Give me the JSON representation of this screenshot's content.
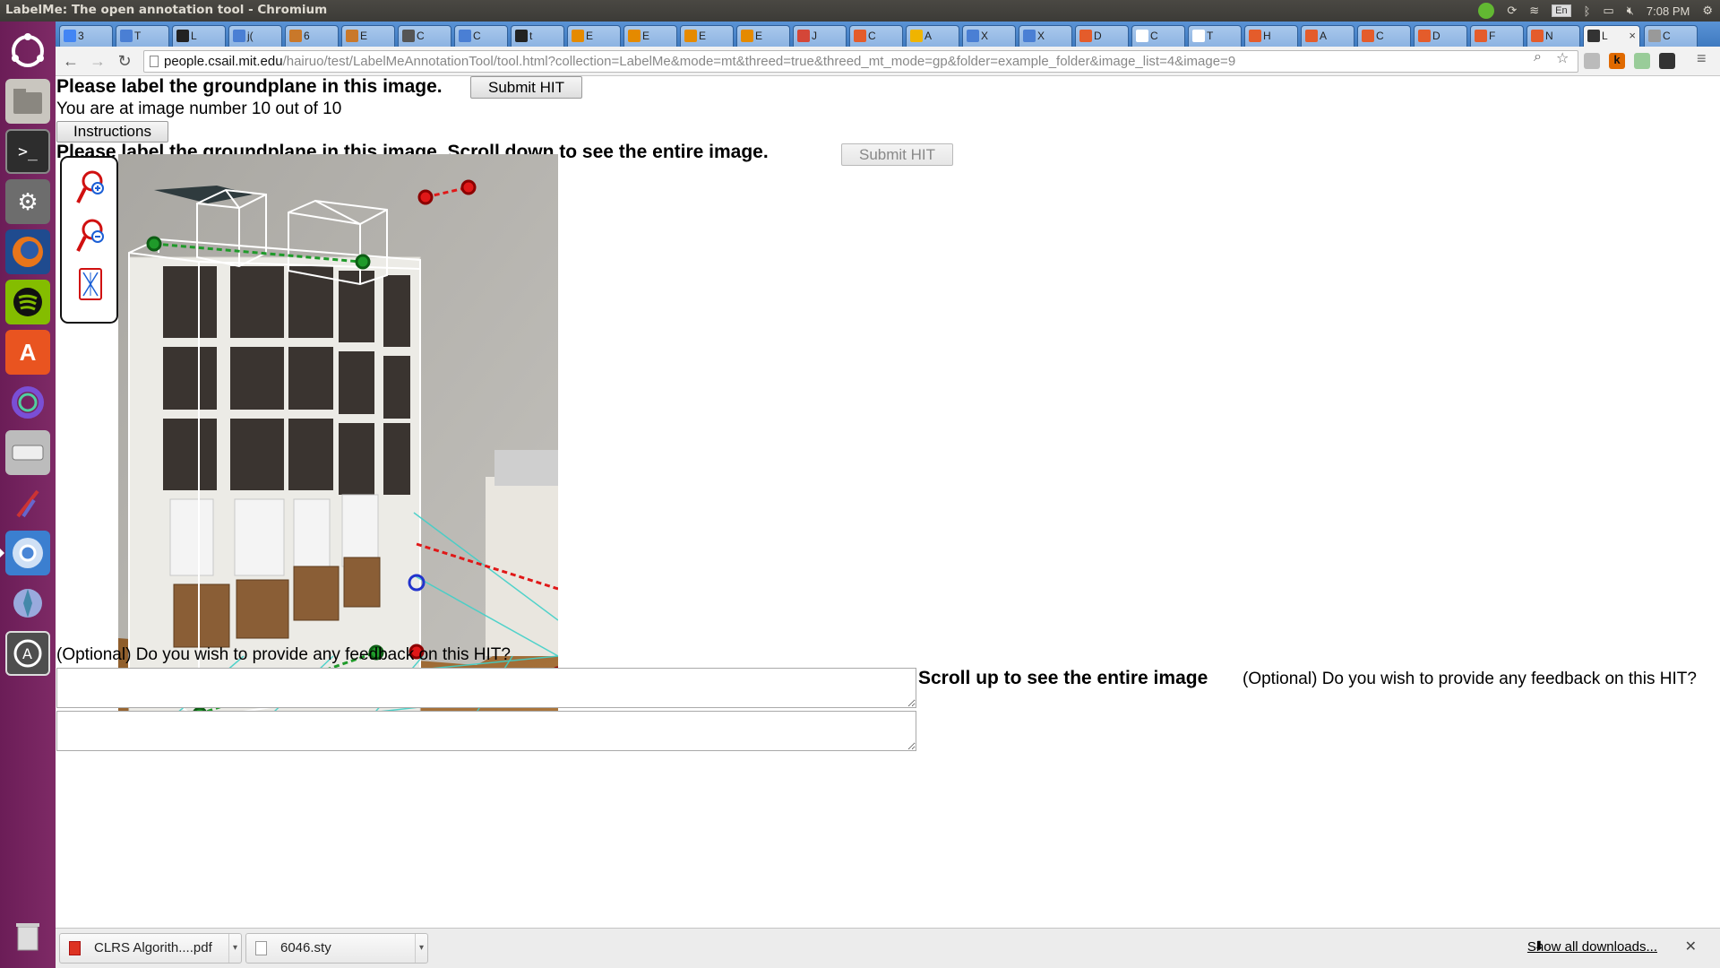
{
  "window": {
    "title": "LabelMe: The open annotation tool - Chromium"
  },
  "tray": {
    "lang": "En",
    "clock": "7:08 PM"
  },
  "tabs": [
    {
      "label": "3",
      "color": "#4285f4"
    },
    {
      "label": "T",
      "color": "#4a7fd4"
    },
    {
      "label": "L",
      "color": "#222222"
    },
    {
      "label": "j(",
      "color": "#4a7fd4"
    },
    {
      "label": "6",
      "color": "#c9782a"
    },
    {
      "label": "E",
      "color": "#c9782a"
    },
    {
      "label": "C",
      "color": "#555555"
    },
    {
      "label": "C",
      "color": "#4a7fd4"
    },
    {
      "label": "t",
      "color": "#222222"
    },
    {
      "label": "E",
      "color": "#e58a00"
    },
    {
      "label": "E",
      "color": "#e58a00"
    },
    {
      "label": "E",
      "color": "#e58a00"
    },
    {
      "label": "E",
      "color": "#e58a00"
    },
    {
      "label": "J",
      "color": "#d44638"
    },
    {
      "label": "C",
      "color": "#e45c2b"
    },
    {
      "label": "A",
      "color": "#f0b400"
    },
    {
      "label": "X",
      "color": "#4a7fd4"
    },
    {
      "label": "X",
      "color": "#4a7fd4"
    },
    {
      "label": "D",
      "color": "#e45c2b"
    },
    {
      "label": "C",
      "color": "#ffffff"
    },
    {
      "label": "T",
      "color": "#ffffff"
    },
    {
      "label": "H",
      "color": "#e45c2b"
    },
    {
      "label": "A",
      "color": "#e45c2b"
    },
    {
      "label": "C",
      "color": "#e45c2b"
    },
    {
      "label": "D",
      "color": "#e45c2b"
    },
    {
      "label": "F",
      "color": "#e45c2b"
    },
    {
      "label": "N",
      "color": "#e45c2b"
    },
    {
      "label": "L",
      "color": "#333333",
      "active": true
    },
    {
      "label": "C",
      "color": "#999999"
    }
  ],
  "omnibox": {
    "host": "people.csail.mit.edu",
    "path": "/hairuo/test/LabelMeAnnotationTool/tool.html?collection=LabelMe&mode=mt&threed=true&threed_mt_mode=gp&folder=example_folder&image_list=4&image=9"
  },
  "page": {
    "heading": "Please label the groundplane in this image.",
    "submit_label": "Submit HIT",
    "status": "You are at image number 10 out of 10",
    "instructions_label": "Instructions",
    "heading2": "Please label the groundplane in this image. Scroll down to see the entire image.",
    "submit2_label": "Submit HIT",
    "feedback_label": "(Optional) Do you wish to provide any feedback on this HIT?",
    "scroll_up": "Scroll up to see the entire image",
    "feedback_label2": "(Optional) Do you wish to provide any feedback on this HIT?"
  },
  "downloads": {
    "items": [
      {
        "name": "CLRS Algorith....pdf"
      },
      {
        "name": "6046.sty"
      }
    ],
    "show_all": "Show all downloads..."
  },
  "colors": {
    "launcher": "#7e2a66",
    "tab_strip": "#4f8bd0",
    "groundplane_line": "#40d0c8",
    "point_green": "#1f9a2a",
    "point_red": "#e01818",
    "point_blue": "#2233cc"
  }
}
